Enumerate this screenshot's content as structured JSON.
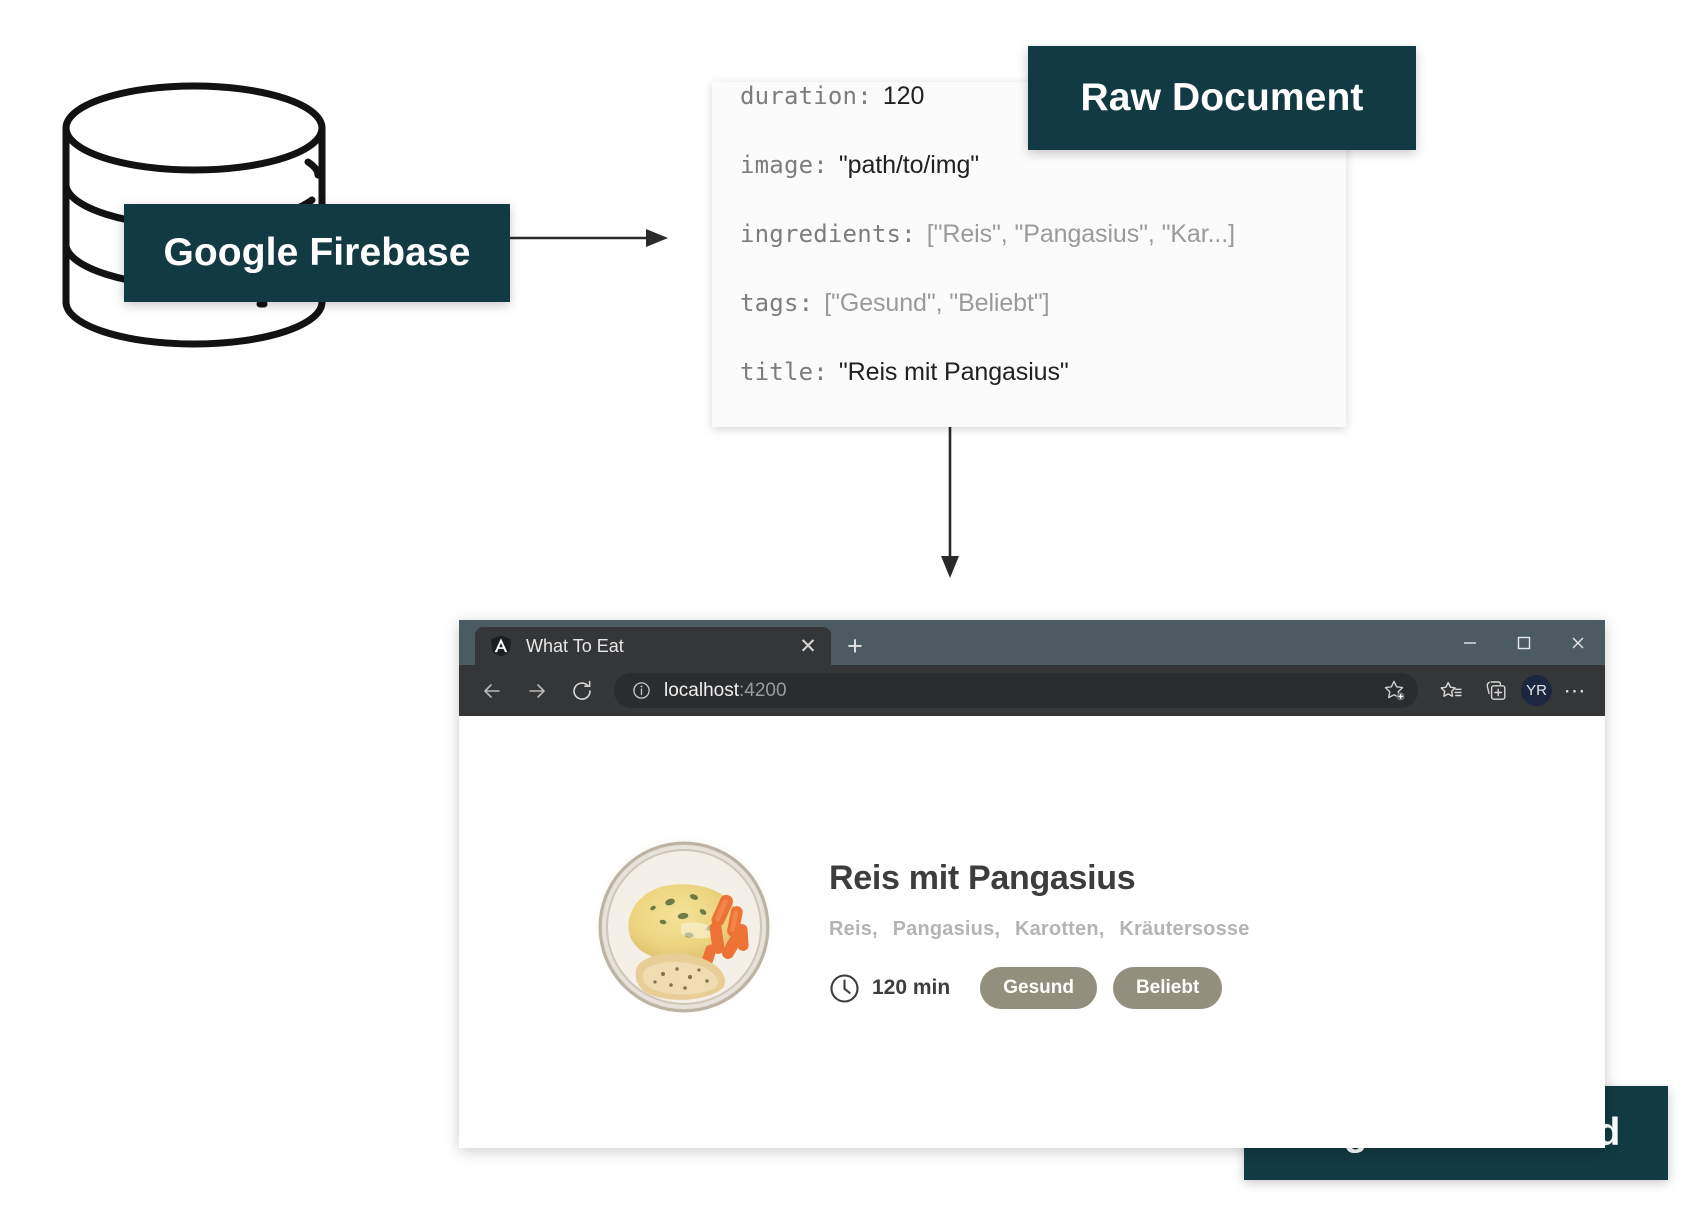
{
  "diagram": {
    "labels": {
      "firebase": "Google Firebase",
      "raw_document": "Raw Document",
      "angular_frontend": "Angular Frontend"
    },
    "badge_color": "#123a42",
    "database_icon": "database-cylinder-icon"
  },
  "raw_document": {
    "lines": [
      {
        "key": "duration:",
        "value": "120",
        "muted": false
      },
      {
        "key": "image:",
        "value": "\"path/to/img\"",
        "muted": false
      },
      {
        "key": "ingredients:",
        "value": "[\"Reis\", \"Pangasius\", \"Kar...]",
        "muted": true
      },
      {
        "key": "tags:",
        "value": "[\"Gesund\", \"Beliebt\"]",
        "muted": true
      },
      {
        "key": "title:",
        "value": "\"Reis mit Pangasius\"",
        "muted": false
      }
    ]
  },
  "browser": {
    "tab": {
      "title": "What To Eat",
      "favicon": "angular-shield-icon",
      "close_label": "✕"
    },
    "new_tab_label": "+",
    "window_controls": {
      "minimize": "minimize-icon",
      "maximize": "maximize-icon",
      "close": "close-icon"
    },
    "toolbar": {
      "back": "back-arrow-icon",
      "forward": "forward-arrow-icon",
      "reload": "reload-icon",
      "site_info": "info-icon",
      "url_host": "localhost",
      "url_port": ":4200",
      "add_favorite": "star-plus-icon",
      "favorites": "favorites-list-icon",
      "collections": "collections-icon",
      "profile_initials": "YR",
      "more_menu": "⋯"
    }
  },
  "page": {
    "recipe": {
      "image_alt": "plate-of-rice-fish-and-carrots",
      "title": "Reis mit Pangasius",
      "ingredients": [
        "Reis,",
        "Pangasius,",
        "Karotten,",
        "Kräutersosse"
      ],
      "duration": "120 min",
      "duration_icon": "clock-icon",
      "tags": [
        "Gesund",
        "Beliebt"
      ],
      "tag_color": "#928f7e"
    }
  }
}
